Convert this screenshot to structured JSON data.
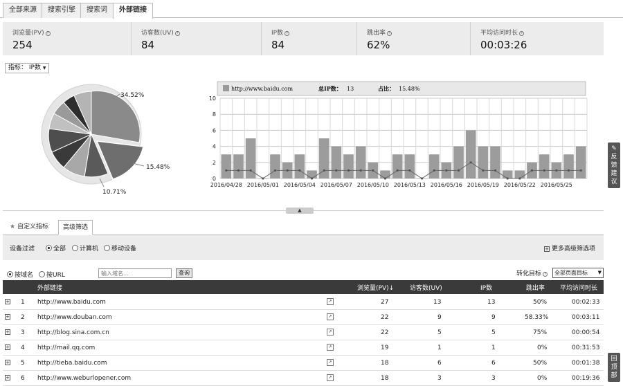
{
  "tabs": [
    "全部来源",
    "搜索引擎",
    "搜索词",
    "外部链接"
  ],
  "stats": [
    {
      "label": "浏览量(PV)",
      "value": "254"
    },
    {
      "label": "访客数(UV)",
      "value": "84"
    },
    {
      "label": "IP数",
      "value": "84"
    },
    {
      "label": "跳出率",
      "value": "62%"
    },
    {
      "label": "平均访问时长",
      "value": "00:03:26"
    }
  ],
  "metric_selector": "指标： IP数",
  "pie_labels": [
    "34.52%",
    "15.48%",
    "10.71%"
  ],
  "chart_data": {
    "type": "bar",
    "legend": {
      "site": "http://www.baidu.com",
      "total_label": "总IP数：",
      "total": "13",
      "share_label": "占比：",
      "share": "15.48%"
    },
    "ylim": [
      0,
      10
    ],
    "yticks": [
      "0",
      "2",
      "4",
      "6",
      "8",
      "10"
    ],
    "xticks": [
      "2016/04/28",
      "2016/05/01",
      "2016/05/04",
      "2016/05/07",
      "2016/05/10",
      "2016/05/13",
      "2016/05/16",
      "2016/05/19",
      "2016/05/22",
      "2016/05/25"
    ],
    "values": [
      3,
      3,
      5,
      0,
      3,
      2,
      3,
      1,
      5,
      4,
      3,
      4,
      2,
      1,
      3,
      3,
      0,
      3,
      2,
      4,
      6,
      4,
      4,
      1,
      1,
      2,
      3,
      2,
      3,
      4
    ],
    "line": [
      1,
      1,
      1,
      0,
      1,
      1,
      1,
      0,
      1,
      1,
      1,
      1,
      1,
      0,
      1,
      1,
      0,
      1,
      1,
      1,
      2,
      1,
      1,
      0,
      0,
      1,
      1,
      1,
      1,
      1
    ]
  },
  "right_tabs": {
    "feedback": "反馈建议",
    "top": "回顶部"
  },
  "collapse_icon": "▲",
  "filter_tabs": [
    "自定义指标",
    "高级筛选"
  ],
  "device_filter": {
    "label": "设备过滤",
    "options": [
      "全部",
      "计算机",
      "移动设备"
    ]
  },
  "more_filters": "更多高级筛选项",
  "search": {
    "opt1": "按域名",
    "opt2": "按URL",
    "placeholder": "输入域名...",
    "button": "查询"
  },
  "conversion": {
    "label": "转化目标",
    "value": "全部页面目标"
  },
  "table": {
    "headers": [
      "外部链接",
      "浏览量(PV)",
      "访客数(UV)",
      "IP数",
      "跳出率",
      "平均访问时长"
    ],
    "sort_icon": "↓",
    "rows": [
      {
        "idx": "1",
        "url": "http://www.baidu.com",
        "pv": "27",
        "uv": "13",
        "ip": "13",
        "bounce": "50%",
        "time": "00:02:33"
      },
      {
        "idx": "2",
        "url": "http://www.douban.com",
        "pv": "22",
        "uv": "9",
        "ip": "9",
        "bounce": "58.33%",
        "time": "00:03:11"
      },
      {
        "idx": "3",
        "url": "http://blog.sina.com.cn",
        "pv": "22",
        "uv": "5",
        "ip": "5",
        "bounce": "75%",
        "time": "00:00:54"
      },
      {
        "idx": "4",
        "url": "http://mail.qq.com",
        "pv": "19",
        "uv": "1",
        "ip": "1",
        "bounce": "0%",
        "time": "00:31:53"
      },
      {
        "idx": "5",
        "url": "http://tieba.baidu.com",
        "pv": "18",
        "uv": "6",
        "ip": "6",
        "bounce": "50%",
        "time": "00:01:38"
      },
      {
        "idx": "6",
        "url": "http://www.weburlopener.com",
        "pv": "18",
        "uv": "3",
        "ip": "3",
        "bounce": "0%",
        "time": "00:19:36"
      }
    ]
  }
}
